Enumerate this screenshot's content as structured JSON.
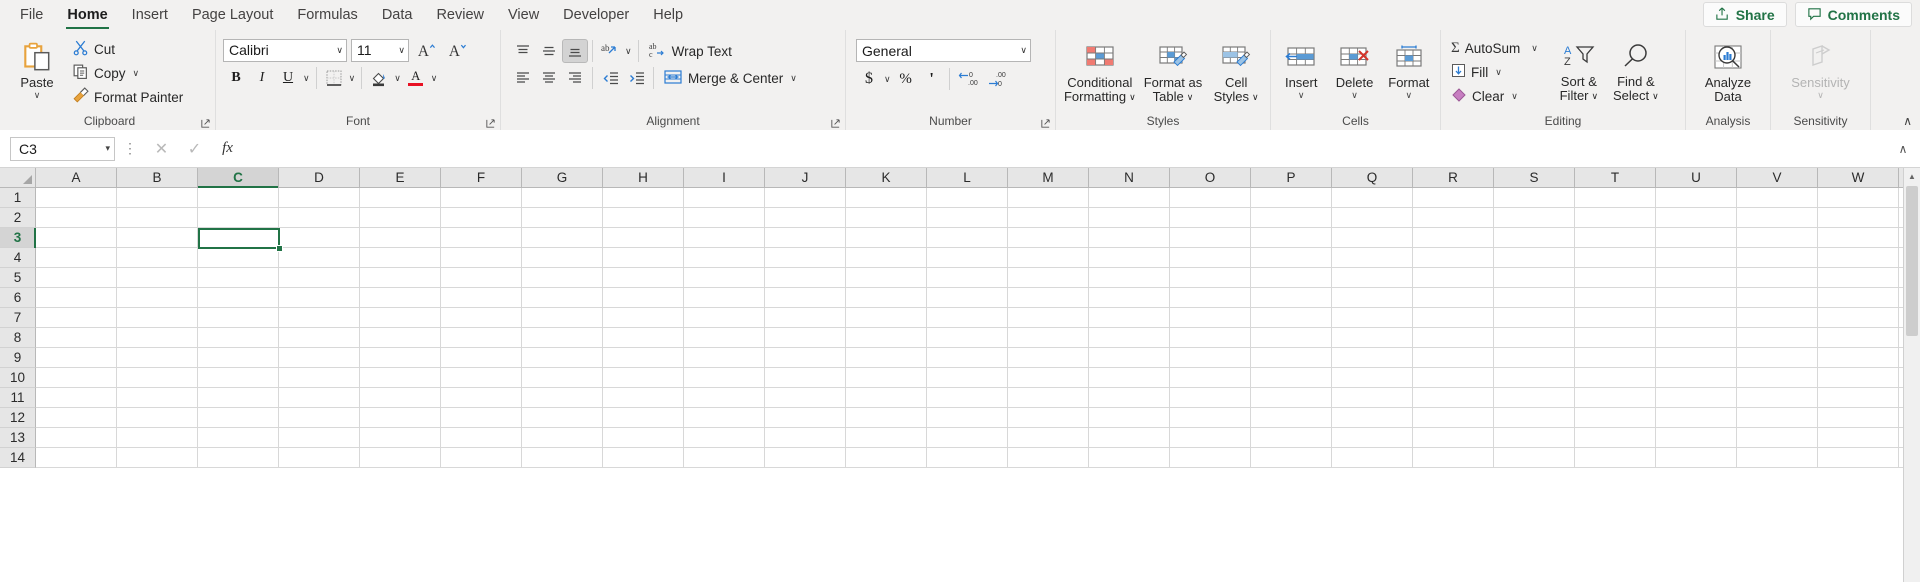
{
  "menu": {
    "tabs": [
      {
        "label": "File",
        "active": false
      },
      {
        "label": "Home",
        "active": true
      },
      {
        "label": "Insert",
        "active": false
      },
      {
        "label": "Page Layout",
        "active": false
      },
      {
        "label": "Formulas",
        "active": false
      },
      {
        "label": "Data",
        "active": false
      },
      {
        "label": "Review",
        "active": false
      },
      {
        "label": "View",
        "active": false
      },
      {
        "label": "Developer",
        "active": false
      },
      {
        "label": "Help",
        "active": false
      }
    ],
    "share_label": "Share",
    "comments_label": "Comments",
    "accent_green": "#217346"
  },
  "ribbon": {
    "collapse_glyph": "∧",
    "clipboard": {
      "group_label": "Clipboard",
      "paste_label": "Paste",
      "paste_caret": "∨",
      "cut_label": "Cut",
      "copy_label": "Copy",
      "copy_caret": "∨",
      "format_painter_label": "Format Painter",
      "dialog_glyph": "⤵"
    },
    "font": {
      "group_label": "Font",
      "font_name": "Calibri",
      "font_size": "11",
      "grow_label": "A",
      "shrink_label": "A",
      "bold_label": "B",
      "italic_label": "I",
      "underline_label": "U",
      "underline_caret": "∨",
      "borders_caret": "∨",
      "fill_caret": "∨",
      "fontcolor_label": "A",
      "fontcolor_caret": "∨",
      "fontcolor_swatch": "#e81123",
      "combo_caret": "∨",
      "dialog_glyph": "⤵"
    },
    "alignment": {
      "group_label": "Alignment",
      "align_top": "align-top",
      "align_middle": "align-middle",
      "align_bottom": "align-bottom",
      "orientation_caret": "∨",
      "wrap_text_label": "Wrap Text",
      "align_left": "align-left",
      "align_center": "align-center",
      "align_right": "align-right",
      "decrease_indent": "decrease-indent",
      "increase_indent": "increase-indent",
      "merge_label": "Merge & Center",
      "merge_caret": "∨",
      "dialog_glyph": "⤵"
    },
    "number": {
      "group_label": "Number",
      "format_value": "General",
      "format_caret": "∨",
      "currency_label": "$",
      "currency_caret": "∨",
      "percent_label": "%",
      "comma_label": "'",
      "increase_decimal": "increase-decimal",
      "decrease_decimal": "decrease-decimal",
      "dialog_glyph": "⤵"
    },
    "styles": {
      "group_label": "Styles",
      "conditional_line1": "Conditional",
      "conditional_line2": "Formatting",
      "conditional_caret": "∨",
      "table_line1": "Format as",
      "table_line2": "Table",
      "table_caret": "∨",
      "cellstyles_line1": "Cell",
      "cellstyles_line2": "Styles",
      "cellstyles_caret": "∨"
    },
    "cells": {
      "group_label": "Cells",
      "insert_label": "Insert",
      "delete_label": "Delete",
      "format_label": "Format",
      "caret": "∨"
    },
    "editing": {
      "group_label": "Editing",
      "autosum_label": "AutoSum",
      "autosum_sigma": "Σ",
      "autosum_caret": "∨",
      "fill_label": "Fill",
      "fill_caret": "∨",
      "clear_label": "Clear",
      "clear_caret": "∨",
      "sort_line1": "Sort &",
      "sort_line2": "Filter",
      "sort_caret": "∨",
      "find_line1": "Find &",
      "find_line2": "Select",
      "find_caret": "∨"
    },
    "analysis": {
      "group_label": "Analysis",
      "analyze_line1": "Analyze",
      "analyze_line2": "Data"
    },
    "sensitivity": {
      "group_label": "Sensitivity",
      "sensitivity_label": "Sensitivity",
      "caret": "∨",
      "disabled": true
    }
  },
  "formula_bar": {
    "name_box_value": "C3",
    "name_box_caret": "▾",
    "cancel_glyph": "✕",
    "enter_glyph": "✓",
    "fx_glyph": "fx",
    "formula_value": "",
    "expand_glyph": "∧"
  },
  "grid": {
    "columns": [
      "A",
      "B",
      "C",
      "D",
      "E",
      "F",
      "G",
      "H",
      "I",
      "J",
      "K",
      "L",
      "M",
      "N",
      "O",
      "P",
      "Q",
      "R",
      "S",
      "T",
      "U",
      "V",
      "W"
    ],
    "rows": [
      "1",
      "2",
      "3",
      "4",
      "5",
      "6",
      "7",
      "8",
      "9",
      "10",
      "11",
      "12",
      "13",
      "14"
    ],
    "selected_cell": "C3",
    "selected_column": "C",
    "selected_row": "3",
    "selection_color": "#217346",
    "scroll_up_glyph": "▲"
  }
}
